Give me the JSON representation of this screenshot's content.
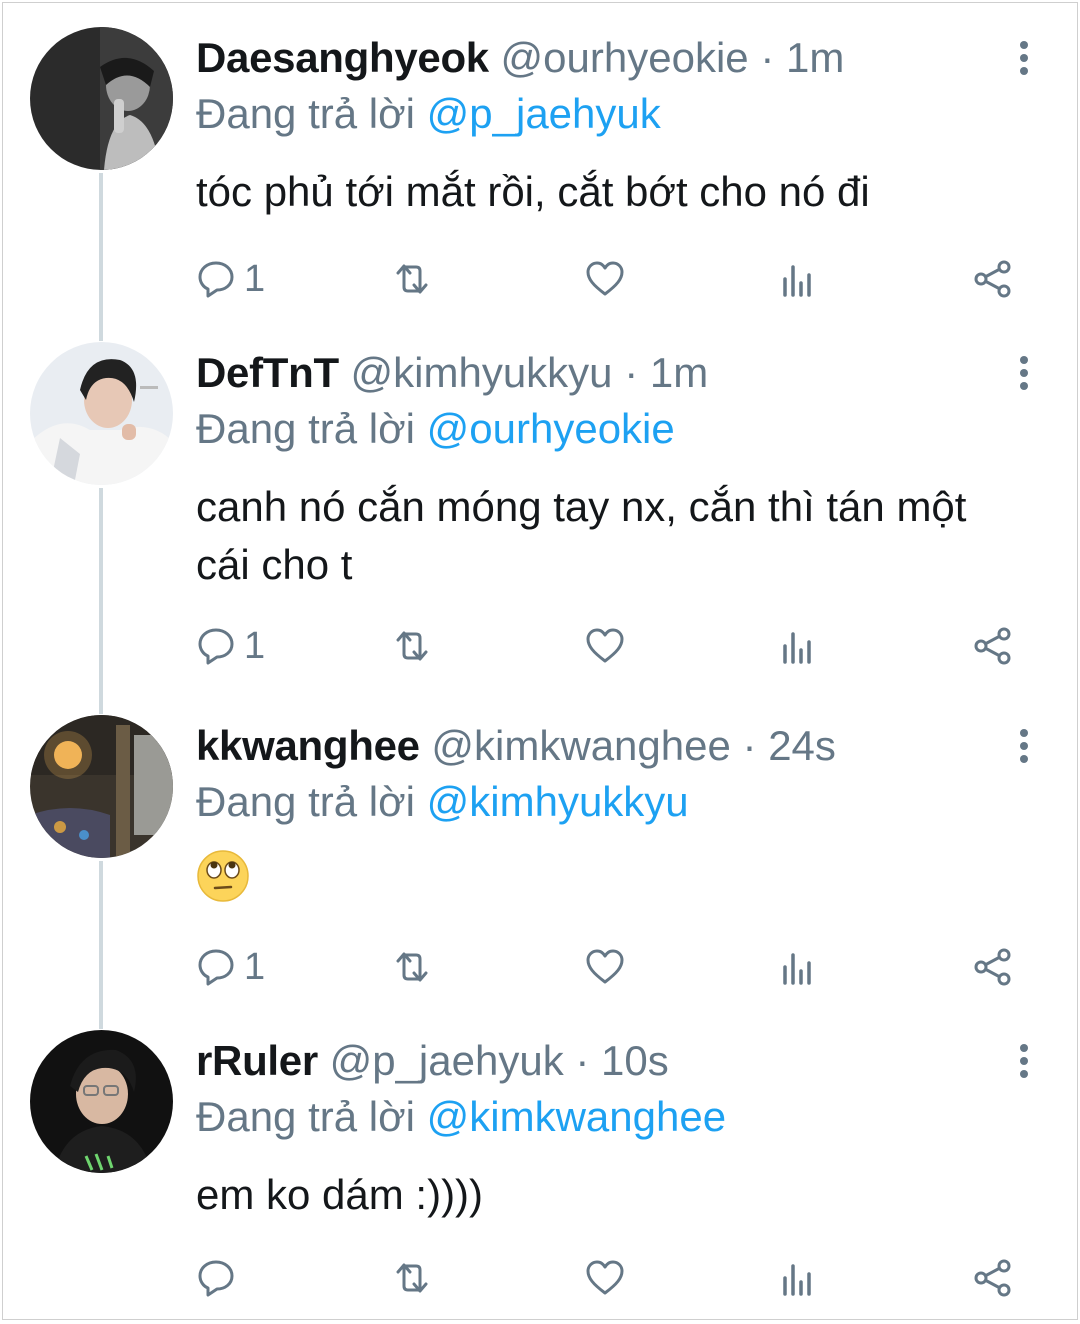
{
  "theme": {
    "name_color": "#14171a",
    "meta_color": "#657786",
    "link_color": "#1da1f2",
    "thread_line_color": "#cfd9de"
  },
  "tweets": [
    {
      "name": "Daesanghyeok",
      "handle": "@ourhyeokie",
      "separator": "·",
      "time": "1m",
      "reply_prefix": "Đang trả lời",
      "reply_to": "@p_jaehyuk",
      "text": "tóc phủ tới mắt rồi, cắt bớt cho nó đi",
      "reply_count": "1",
      "icons": [
        "reply-icon",
        "retweet-icon",
        "like-icon",
        "analytics-icon",
        "share-icon",
        "more-options-icon"
      ]
    },
    {
      "name": "DefTnT",
      "handle": "@kimhyukkyu",
      "separator": "·",
      "time": "1m",
      "reply_prefix": "Đang trả lời",
      "reply_to": "@ourhyeokie",
      "text": "canh nó cắn móng tay nx, cắn thì tán một cái cho t",
      "reply_count": "1"
    },
    {
      "name": "kkwanghee",
      "handle": "@kimkwanghee",
      "separator": "·",
      "time": "24s",
      "reply_prefix": "Đang trả lời",
      "reply_to": "@kimhyukkyu",
      "emoji": "face-with-rolling-eyes",
      "reply_count": "1"
    },
    {
      "name": "rRuler",
      "handle": "@p_jaehyuk",
      "separator": "·",
      "time": "10s",
      "reply_prefix": "Đang trả lời",
      "reply_to": "@kimkwanghee",
      "text": "em ko dám :))))",
      "reply_count": ""
    }
  ]
}
